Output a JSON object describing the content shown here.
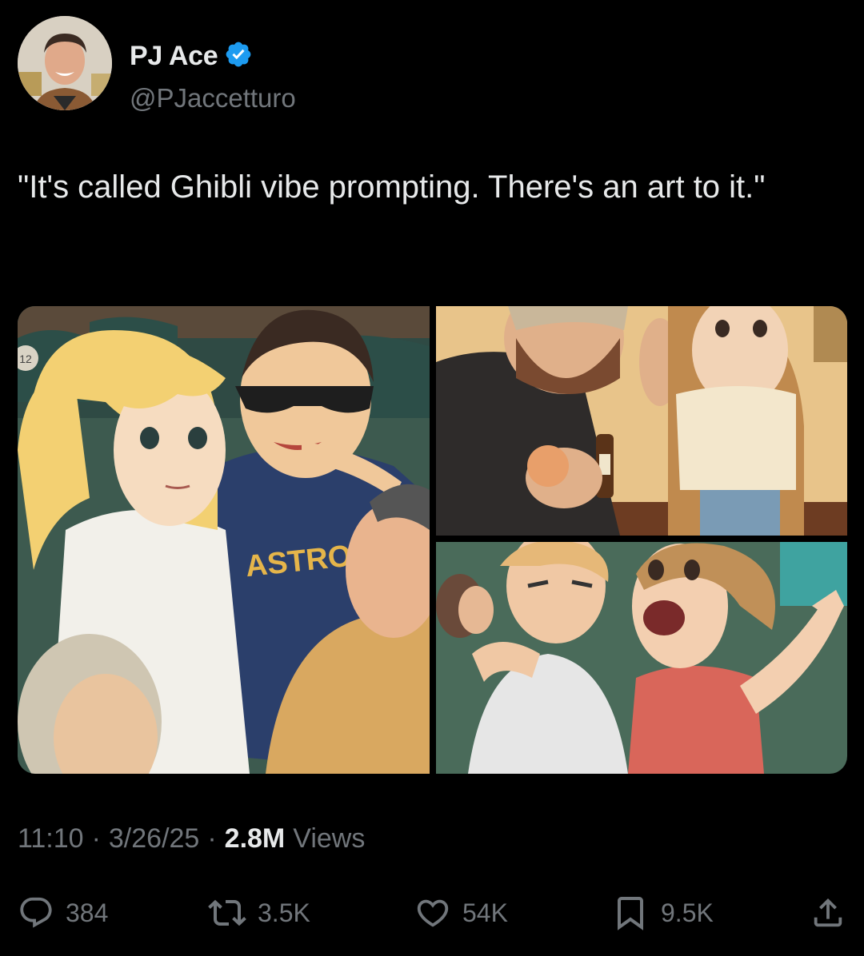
{
  "author": {
    "display_name": "PJ Ace",
    "handle": "@PJaccetturo",
    "verified": true
  },
  "tweet": {
    "text": "\"It's called Ghibli vibe prompting. There's an art to it.\""
  },
  "media": {
    "panel_left": {
      "jersey_text": "ASTROS",
      "seat_number": "12"
    }
  },
  "meta": {
    "time": "11:10",
    "date": "3/26/25",
    "views_count": "2.8M",
    "views_label": "Views"
  },
  "actions": {
    "replies": "384",
    "reposts": "3.5K",
    "likes": "54K",
    "bookmarks": "9.5K"
  },
  "colors": {
    "background": "#000000",
    "text_primary": "#e7e9ea",
    "text_secondary": "#71767b",
    "verified_badge": "#1d9bf0"
  }
}
